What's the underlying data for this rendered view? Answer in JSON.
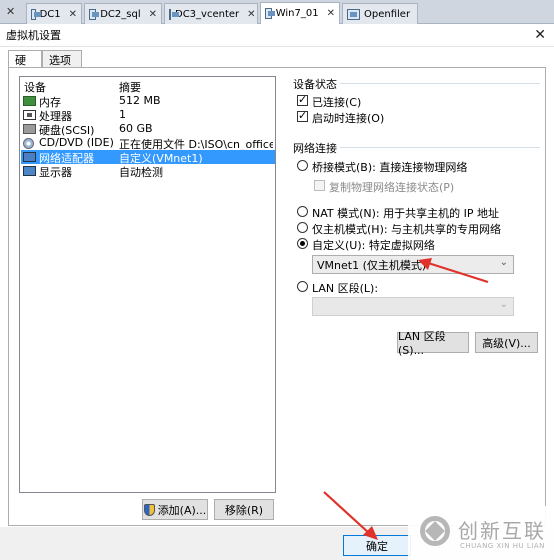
{
  "tabs": [
    {
      "label": "DC1"
    },
    {
      "label": "DC2_sql"
    },
    {
      "label": "DC3_vcenter"
    },
    {
      "label": "Win7_01"
    },
    {
      "label": "Openfiler"
    }
  ],
  "dialog": {
    "title": "虚拟机设置",
    "close_symbol": "✕"
  },
  "inner_tabs": [
    "硬件",
    "选项"
  ],
  "device_list": {
    "col_device": "设备",
    "col_summary": "摘要",
    "rows": [
      {
        "name": "内存",
        "value": "512 MB",
        "icon": "memory-icon"
      },
      {
        "name": "处理器",
        "value": "1",
        "icon": "processor-icon"
      },
      {
        "name": "硬盘(SCSI)",
        "value": "60 GB",
        "icon": "hard-disk-icon"
      },
      {
        "name": "CD/DVD (IDE)",
        "value": "正在使用文件 D:\\ISO\\cn_office_p...",
        "icon": "cd-dvd-icon"
      },
      {
        "name": "网络适配器",
        "value": "自定义(VMnet1)",
        "icon": "network-adapter-icon",
        "selected": true
      },
      {
        "name": "显示器",
        "value": "自动检测",
        "icon": "display-icon"
      }
    ],
    "add_button": "添加(A)...",
    "remove_button": "移除(R)"
  },
  "device_status": {
    "title": "设备状态",
    "connected": "已连接(C)",
    "connect_at_power_on": "启动时连接(O)"
  },
  "network_connection": {
    "title": "网络连接",
    "bridged": "桥接模式(B): 直接连接物理网络",
    "replicate_state": "复制物理网络连接状态(P)",
    "nat": "NAT 模式(N): 用于共享主机的 IP 地址",
    "host_only": "仅主机模式(H): 与主机共享的专用网络",
    "custom": "自定义(U): 特定虚拟网络",
    "custom_selected": "VMnet1 (仅主机模式)",
    "lan_segment": "LAN 区段(L):",
    "lan_segments_button": "LAN 区段(S)...",
    "advanced_button": "高级(V)..."
  },
  "footer": {
    "ok_button": "确定"
  },
  "watermark": {
    "cn": "创新互联",
    "en": "CHUANG XIN HU LIAN"
  },
  "colors": {
    "selection": "#3399ff",
    "annotation_arrow": "#e0322a"
  }
}
